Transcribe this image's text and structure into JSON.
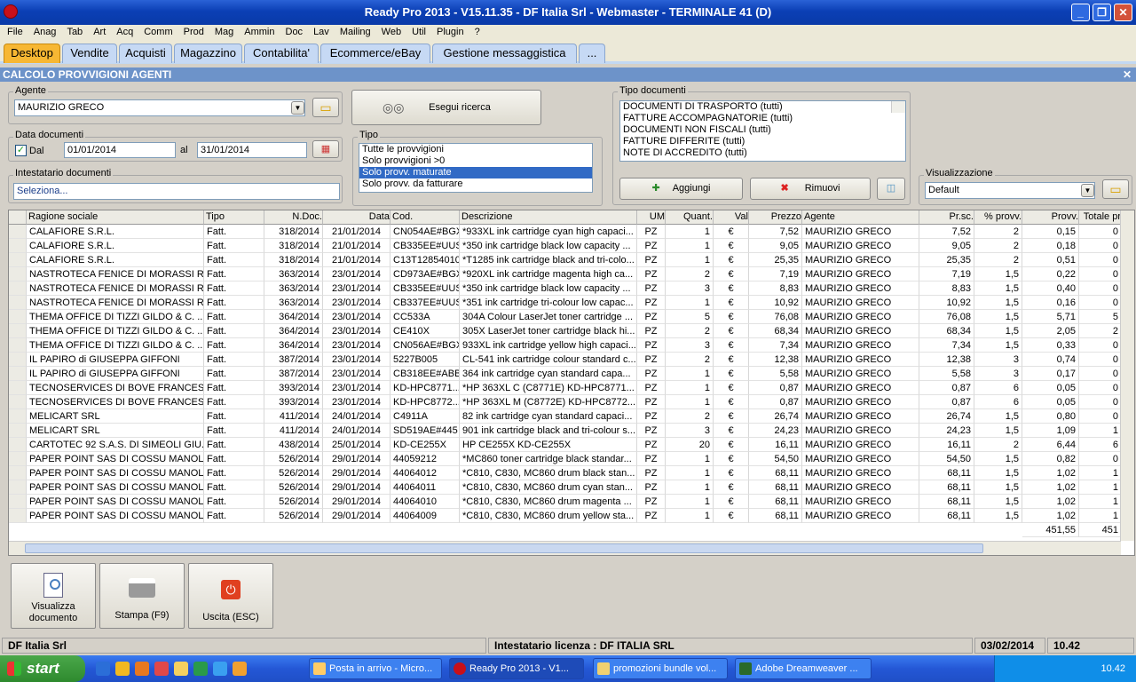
{
  "window": {
    "title": "Ready Pro 2013 - V15.11.35 - DF Italia Srl - Webmaster - TERMINALE 41 (D)",
    "min": "_",
    "max": "❐",
    "close": "✕"
  },
  "menu": [
    "File",
    "Anag",
    "Tab",
    "Art",
    "Acq",
    "Comm",
    "Prod",
    "Mag",
    "Ammin",
    "Doc",
    "Lav",
    "Mailing",
    "Web",
    "Util",
    "Plugin",
    "?"
  ],
  "tabs": [
    "Desktop",
    "Vendite",
    "Acquisti",
    "Magazzino",
    "Contabilita'",
    "Ecommerce/eBay",
    "Gestione messaggistica",
    "..."
  ],
  "panel": {
    "title": "CALCOLO PROVVIGIONI AGENTI",
    "close": "✕"
  },
  "agente": {
    "label": "Agente",
    "value": "MAURIZIO GRECO"
  },
  "search": {
    "label": "Esegui ricerca"
  },
  "data_documenti": {
    "label": "Data documenti",
    "dal_label": "Dal",
    "dal": "01/01/2014",
    "al_label": "al",
    "al": "31/01/2014"
  },
  "tipo": {
    "label": "Tipo",
    "options": [
      "Tutte le provvigioni",
      "Solo provvigioni >0",
      "Solo provv. maturate",
      "Solo provv. da fatturare"
    ],
    "selected": 2
  },
  "intestatario": {
    "label": "Intestatario documenti",
    "placeholder": "Seleziona..."
  },
  "tipo_documenti": {
    "label": "Tipo documenti",
    "items": [
      "DOCUMENTI DI TRASPORTO (tutti)",
      "FATTURE ACCOMPAGNATORIE (tutti)",
      "DOCUMENTI NON FISCALI (tutti)",
      "FATTURE DIFFERITE (tutti)",
      "NOTE DI ACCREDITO (tutti)"
    ],
    "add": "Aggiungi",
    "remove": "Rimuovi"
  },
  "visualizzazione": {
    "label": "Visualizzazione",
    "value": "Default"
  },
  "columns": [
    "Ragione sociale",
    "Tipo",
    "N.Doc.",
    "Data",
    "Cod.",
    "Descrizione",
    "UM",
    "Quant.",
    "Val",
    "Prezzo",
    "Agente",
    "Pr.sc.",
    "% provv.",
    "Provv.",
    "Totale pr"
  ],
  "rows": [
    [
      "CALAFIORE S.R.L.",
      "Fatt.",
      "318/2014",
      "21/01/2014",
      "CN054AE#BGX",
      "*933XL ink cartridge cyan high capaci...",
      "PZ",
      "1",
      "€",
      "7,52",
      "MAURIZIO GRECO",
      "7,52",
      "2",
      "0,15",
      "0"
    ],
    [
      "CALAFIORE S.R.L.",
      "Fatt.",
      "318/2014",
      "21/01/2014",
      "CB335EE#UUS",
      "*350 ink cartridge black low capacity ...",
      "PZ",
      "1",
      "€",
      "9,05",
      "MAURIZIO GRECO",
      "9,05",
      "2",
      "0,18",
      "0"
    ],
    [
      "CALAFIORE S.R.L.",
      "Fatt.",
      "318/2014",
      "21/01/2014",
      "C13T12854010",
      "*T1285 ink cartridge black and tri-colo...",
      "PZ",
      "1",
      "€",
      "25,35",
      "MAURIZIO GRECO",
      "25,35",
      "2",
      "0,51",
      "0"
    ],
    [
      "NASTROTECA FENICE DI MORASSI R...",
      "Fatt.",
      "363/2014",
      "23/01/2014",
      "CD973AE#BGX",
      "*920XL ink cartridge magenta high ca...",
      "PZ",
      "2",
      "€",
      "7,19",
      "MAURIZIO GRECO",
      "7,19",
      "1,5",
      "0,22",
      "0"
    ],
    [
      "NASTROTECA FENICE DI MORASSI R...",
      "Fatt.",
      "363/2014",
      "23/01/2014",
      "CB335EE#UUS",
      "*350 ink cartridge black low capacity ...",
      "PZ",
      "3",
      "€",
      "8,83",
      "MAURIZIO GRECO",
      "8,83",
      "1,5",
      "0,40",
      "0"
    ],
    [
      "NASTROTECA FENICE DI MORASSI R...",
      "Fatt.",
      "363/2014",
      "23/01/2014",
      "CB337EE#UUS",
      "*351 ink cartridge tri-colour low capac...",
      "PZ",
      "1",
      "€",
      "10,92",
      "MAURIZIO GRECO",
      "10,92",
      "1,5",
      "0,16",
      "0"
    ],
    [
      "THEMA OFFICE DI TIZZI GILDO & C. ...",
      "Fatt.",
      "364/2014",
      "23/01/2014",
      "CC533A",
      "304A Colour LaserJet toner cartridge ...",
      "PZ",
      "5",
      "€",
      "76,08",
      "MAURIZIO GRECO",
      "76,08",
      "1,5",
      "5,71",
      "5"
    ],
    [
      "THEMA OFFICE DI TIZZI GILDO & C. ...",
      "Fatt.",
      "364/2014",
      "23/01/2014",
      "CE410X",
      "305X LaserJet toner cartridge black hi...",
      "PZ",
      "2",
      "€",
      "68,34",
      "MAURIZIO GRECO",
      "68,34",
      "1,5",
      "2,05",
      "2"
    ],
    [
      "THEMA OFFICE DI TIZZI GILDO & C. ...",
      "Fatt.",
      "364/2014",
      "23/01/2014",
      "CN056AE#BGX",
      "933XL ink cartridge yellow high capaci...",
      "PZ",
      "3",
      "€",
      "7,34",
      "MAURIZIO GRECO",
      "7,34",
      "1,5",
      "0,33",
      "0"
    ],
    [
      "IL PAPIRO di GIUSEPPA GIFFONI",
      "Fatt.",
      "387/2014",
      "23/01/2014",
      "5227B005",
      "CL-541 ink cartridge colour standard c...",
      "PZ",
      "2",
      "€",
      "12,38",
      "MAURIZIO GRECO",
      "12,38",
      "3",
      "0,74",
      "0"
    ],
    [
      "IL PAPIRO di GIUSEPPA GIFFONI",
      "Fatt.",
      "387/2014",
      "23/01/2014",
      "CB318EE#ABB",
      "364 ink cartridge cyan standard capa...",
      "PZ",
      "1",
      "€",
      "5,58",
      "MAURIZIO GRECO",
      "5,58",
      "3",
      "0,17",
      "0"
    ],
    [
      "TECNOSERVICES  DI BOVE FRANCES...",
      "Fatt.",
      "393/2014",
      "23/01/2014",
      "KD-HPC8771...",
      "*HP 363XL C (C8771E) KD-HPC8771...",
      "PZ",
      "1",
      "€",
      "0,87",
      "MAURIZIO GRECO",
      "0,87",
      "6",
      "0,05",
      "0"
    ],
    [
      "TECNOSERVICES  DI BOVE FRANCES...",
      "Fatt.",
      "393/2014",
      "23/01/2014",
      "KD-HPC8772...",
      "*HP 363XL M (C8772E) KD-HPC8772...",
      "PZ",
      "1",
      "€",
      "0,87",
      "MAURIZIO GRECO",
      "0,87",
      "6",
      "0,05",
      "0"
    ],
    [
      "MELICART SRL",
      "Fatt.",
      "411/2014",
      "24/01/2014",
      "C4911A",
      "82 ink cartridge cyan standard capaci...",
      "PZ",
      "2",
      "€",
      "26,74",
      "MAURIZIO GRECO",
      "26,74",
      "1,5",
      "0,80",
      "0"
    ],
    [
      "MELICART SRL",
      "Fatt.",
      "411/2014",
      "24/01/2014",
      "SD519AE#445",
      "901 ink cartridge black and tri-colour s...",
      "PZ",
      "3",
      "€",
      "24,23",
      "MAURIZIO GRECO",
      "24,23",
      "1,5",
      "1,09",
      "1"
    ],
    [
      "CARTOTEC 92 S.A.S. DI SIMEOLI GIU...",
      "Fatt.",
      "438/2014",
      "25/01/2014",
      "KD-CE255X",
      "HP CE255X KD-CE255X",
      "PZ",
      "20",
      "€",
      "16,11",
      "MAURIZIO GRECO",
      "16,11",
      "2",
      "6,44",
      "6"
    ],
    [
      "PAPER POINT SAS DI COSSU MANOL...",
      "Fatt.",
      "526/2014",
      "29/01/2014",
      "44059212",
      "*MC860 toner cartridge black standar...",
      "PZ",
      "1",
      "€",
      "54,50",
      "MAURIZIO GRECO",
      "54,50",
      "1,5",
      "0,82",
      "0"
    ],
    [
      "PAPER POINT SAS DI COSSU MANOL...",
      "Fatt.",
      "526/2014",
      "29/01/2014",
      "44064012",
      "*C810, C830, MC860 drum black stan...",
      "PZ",
      "1",
      "€",
      "68,11",
      "MAURIZIO GRECO",
      "68,11",
      "1,5",
      "1,02",
      "1"
    ],
    [
      "PAPER POINT SAS DI COSSU MANOL...",
      "Fatt.",
      "526/2014",
      "29/01/2014",
      "44064011",
      "*C810, C830, MC860 drum cyan stan...",
      "PZ",
      "1",
      "€",
      "68,11",
      "MAURIZIO GRECO",
      "68,11",
      "1,5",
      "1,02",
      "1"
    ],
    [
      "PAPER POINT SAS DI COSSU MANOL...",
      "Fatt.",
      "526/2014",
      "29/01/2014",
      "44064010",
      "*C810, C830, MC860 drum magenta ...",
      "PZ",
      "1",
      "€",
      "68,11",
      "MAURIZIO GRECO",
      "68,11",
      "1,5",
      "1,02",
      "1"
    ],
    [
      "PAPER POINT SAS DI COSSU MANOL...",
      "Fatt.",
      "526/2014",
      "29/01/2014",
      "44064009",
      "*C810, C830, MC860 drum yellow sta...",
      "PZ",
      "1",
      "€",
      "68,11",
      "MAURIZIO GRECO",
      "68,11",
      "1,5",
      "1,02",
      "1"
    ]
  ],
  "totals": {
    "provv": "451,55",
    "totale": "451"
  },
  "actions": {
    "view": "Visualizza documento",
    "print": "Stampa (F9)",
    "exit": "Uscita (ESC)"
  },
  "status": {
    "company": "DF Italia Srl",
    "license": "Intestatario licenza : DF ITALIA SRL",
    "date": "03/02/2014",
    "time": "10.42"
  },
  "taskbar": {
    "start": "start",
    "tasks": [
      "Posta in arrivo - Micro...",
      "Ready Pro 2013 - V1...",
      "promozioni bundle vol...",
      "Adobe Dreamweaver ..."
    ],
    "clock": "10.42"
  }
}
